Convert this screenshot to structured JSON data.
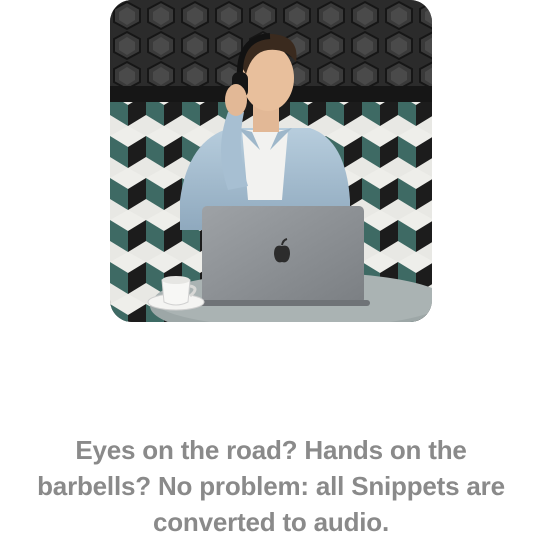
{
  "caption": {
    "lines": [
      "Eyes on the road? Hands on the",
      "barbells? No problem: all Snippets are",
      "converted to audio."
    ]
  },
  "photo": {
    "subject": "man wearing headphones working on a laptop",
    "colors": {
      "wall_top": "#2a2a2a",
      "tile_light": "#e9e9e6",
      "tile_teal": "#3f6c66",
      "tile_dark": "#1b1b1b",
      "shirt": "#aac3d6",
      "laptop": "#8f9397",
      "table": "#9aa4a4"
    }
  }
}
